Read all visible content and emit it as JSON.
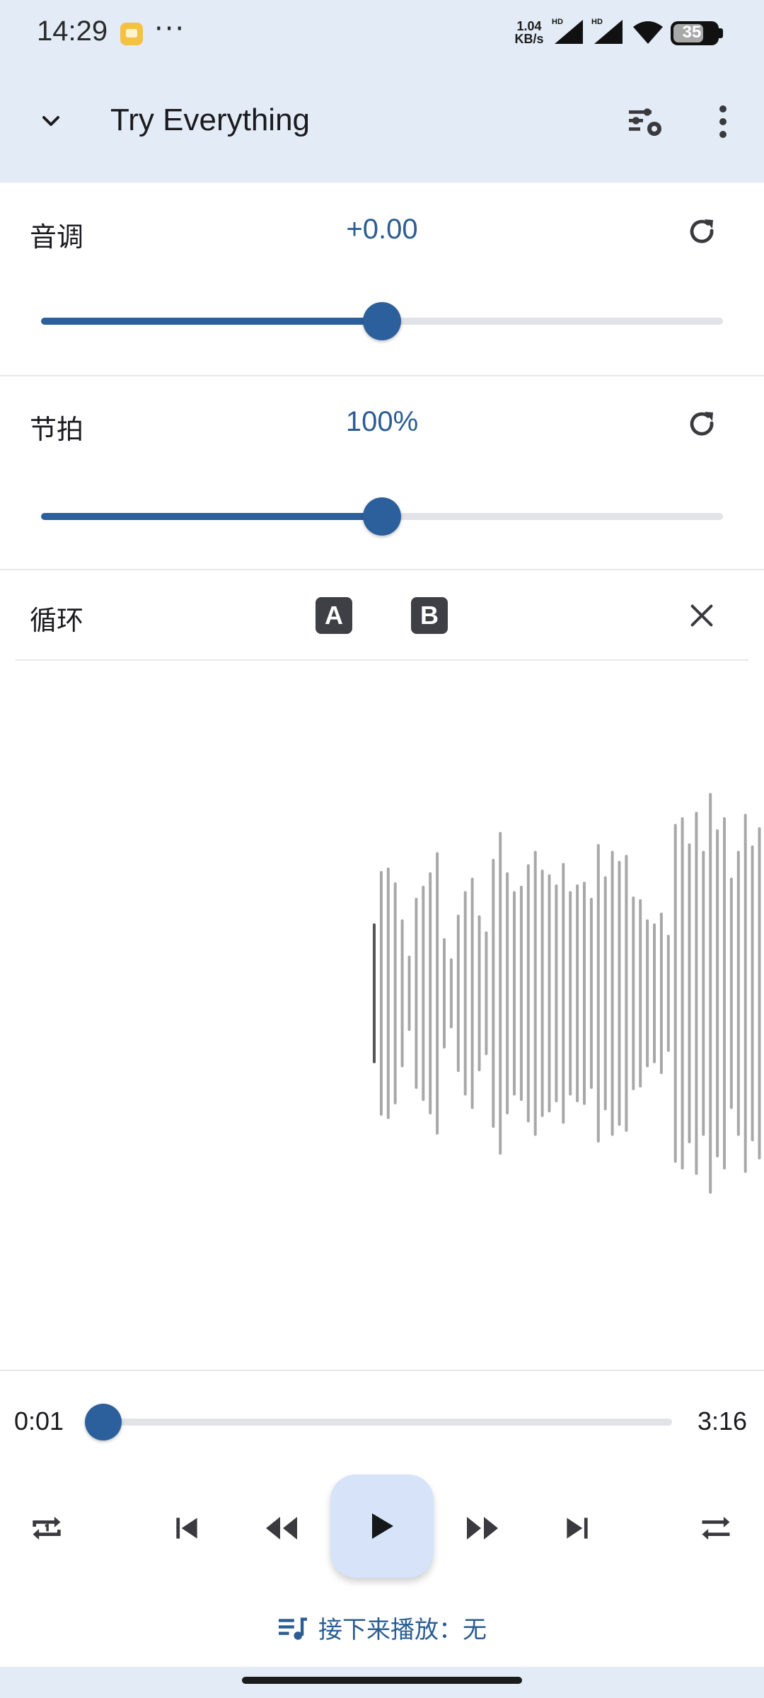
{
  "status_bar": {
    "time": "14:29",
    "more": "···",
    "net_speed_value": "1.04",
    "net_speed_unit": "KB/s",
    "hd_1": "HD",
    "hd_2": "HD",
    "battery": "35"
  },
  "app_bar": {
    "title": "Try Everything",
    "icons": [
      "chevron-down-icon",
      "equalizer-settings-icon",
      "more-vert-icon"
    ]
  },
  "pitch": {
    "label": "音调",
    "value": "+0.00",
    "level_fraction": 0.5,
    "icon": "reset-icon"
  },
  "tempo": {
    "label": "节拍",
    "value": "100%",
    "level_fraction": 0.5,
    "icon": "reset-icon"
  },
  "loop": {
    "label": "循环",
    "point_a": "A",
    "point_b": "B",
    "icon": "close-icon"
  },
  "waveform": {
    "played_color": "#555555",
    "unplayed_color": "#a8a8a8"
  },
  "progress": {
    "current": "0:01",
    "total": "3:16",
    "fraction": 0.005
  },
  "controls": {
    "icons": [
      "repeat-one-icon",
      "skip-previous-icon",
      "rewind-icon",
      "play-icon",
      "fast-forward-icon",
      "skip-next-icon",
      "repeat-icon"
    ]
  },
  "up_next": {
    "icon": "queue-music-icon",
    "text": "接下来播放：无"
  },
  "colors": {
    "accent": "#2c609c",
    "header_bg": "#e3ebf6",
    "play_bg": "#d6e3f8"
  }
}
